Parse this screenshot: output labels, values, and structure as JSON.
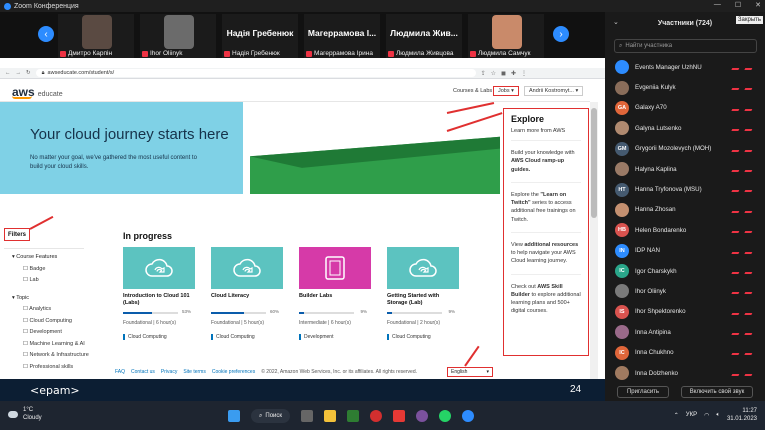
{
  "zoom": {
    "title": "Zoom Конференция",
    "close_label": "Закрыть"
  },
  "gallery": {
    "tiles": [
      {
        "label": "Дмитро Карпін",
        "has_video": true
      },
      {
        "label": "Ihor Oliinyk",
        "has_video": true
      },
      {
        "label": "Надія Гребенюк",
        "name": "Надія Гребенюк",
        "has_video": false
      },
      {
        "label": "Магеррамова Ірина",
        "name": "Магеррамова І...",
        "has_video": false
      },
      {
        "label": "Людмила Живцова",
        "name": "Людмила Жив...",
        "has_video": false
      },
      {
        "label": "Людмила Самчук",
        "has_video": true
      }
    ]
  },
  "browser": {
    "url": "awseducate.com/student/s/"
  },
  "aws": {
    "logo": "aws",
    "logo_sub": "educate",
    "nav_courses": "Courses & Labs",
    "nav_jobs": "Jobs",
    "nav_user": "Andrii Kostromyt...",
    "hero_title": "Your cloud journey starts here",
    "hero_text": "No matter your goal, we've gathered the most useful content to build your cloud skills.",
    "filters_label": "Filters",
    "filters": {
      "course_features_label": "Course Features",
      "course_features": [
        "Badge",
        "Lab"
      ],
      "topic_label": "Topic",
      "topics": [
        "Analytics",
        "Cloud Computing",
        "Development",
        "Machine Learning & AI",
        "Network & Infrastructure",
        "Professional skills"
      ]
    },
    "in_progress_label": "In progress",
    "cards": [
      {
        "title": "Introduction to Cloud 101 (Labs)",
        "progress": 53,
        "level": "Foundational | 6 hour(s)",
        "category": "Cloud Computing",
        "color": "#5cc3c0",
        "icon": "cloud-icon"
      },
      {
        "title": "Cloud Literacy",
        "progress": 60,
        "level": "Foundational | 5 hour(s)",
        "category": "Cloud Computing",
        "color": "#5cc3c0",
        "icon": "cloud-icon"
      },
      {
        "title": "Builder Labs",
        "progress": 9,
        "level": "Intermediate | 6 hour(s)",
        "category": "Development",
        "color": "#d63aa8",
        "icon": "devices-icon"
      },
      {
        "title": "Getting Started with Storage (Lab)",
        "progress": 9,
        "level": "Foundational | 2 hour(s)",
        "category": "Cloud Computing",
        "color": "#5cc3c0",
        "icon": "cloud-icon"
      }
    ],
    "explore": {
      "title": "Explore",
      "subtitle": "Learn more from AWS",
      "items": [
        {
          "pre": "Build your knowledge with ",
          "bold": "AWS Cloud ramp-up guides.",
          "post": ""
        },
        {
          "pre": "Explore the ",
          "bold": "\"Learn on Twitch\"",
          "post": " series to access additional free trainings on Twitch."
        },
        {
          "pre": "View ",
          "bold": "additional resources",
          "post": " to help navigate your AWS Cloud learning journey."
        },
        {
          "pre": "Check out ",
          "bold": "AWS Skill Builder",
          "post": " to explore additional learning plans and 500+ digital courses."
        }
      ]
    },
    "footer_links": [
      "FAQ",
      "Contact us",
      "Privacy",
      "Site terms",
      "Cookie preferences"
    ],
    "footer_copyright": "© 2022, Amazon Web Services, Inc. or its affiliates. All rights reserved.",
    "language": "English"
  },
  "presentation": {
    "brand": "<epam>",
    "slide_number": "24"
  },
  "participants": {
    "header": "Участники (724)",
    "search_placeholder": "Найти участника",
    "list": [
      {
        "name": "Events Manager UzhNU",
        "initials": "",
        "color": "#2d8cff"
      },
      {
        "name": "Evgeniia Kulyk",
        "initials": "",
        "color": "#8a6d5a"
      },
      {
        "name": "Galaxy A70",
        "initials": "GA",
        "color": "#e0663a"
      },
      {
        "name": "Galyna Lutsenko",
        "initials": "",
        "color": "#b08a70"
      },
      {
        "name": "Grygorii Mozolevych (MOH)",
        "initials": "GM",
        "color": "#455a70"
      },
      {
        "name": "Halyna Kaplina",
        "initials": "",
        "color": "#9a7a66"
      },
      {
        "name": "Hanna Tryfonova (MSU)",
        "initials": "HT",
        "color": "#455a70"
      },
      {
        "name": "Hanna Zhosan",
        "initials": "",
        "color": "#c49070"
      },
      {
        "name": "Helen Bondarenko",
        "initials": "HB",
        "color": "#d9534f"
      },
      {
        "name": "IDP NAN",
        "initials": "IN",
        "color": "#2d8cff"
      },
      {
        "name": "Igor Charskykh",
        "initials": "IC",
        "color": "#2aa68a"
      },
      {
        "name": "Ihor Oliinyk",
        "initials": "",
        "color": "#7a7a7a"
      },
      {
        "name": "Ihor Shpektorenko",
        "initials": "IS",
        "color": "#d9534f"
      },
      {
        "name": "Inna Antipina",
        "initials": "",
        "color": "#9a6a8a"
      },
      {
        "name": "Inna Chukhno",
        "initials": "IC",
        "color": "#e0663a"
      },
      {
        "name": "Inna Dolzhenko",
        "initials": "",
        "color": "#a07a60"
      }
    ],
    "invite_label": "Пригласить",
    "unmute_all_label": "Включить свой звук"
  },
  "taskbar": {
    "weather_temp": "1°C",
    "weather_text": "Cloudy",
    "search_label": "Поиск",
    "language": "УКР",
    "time": "11:27",
    "date": "31.01.2023"
  }
}
